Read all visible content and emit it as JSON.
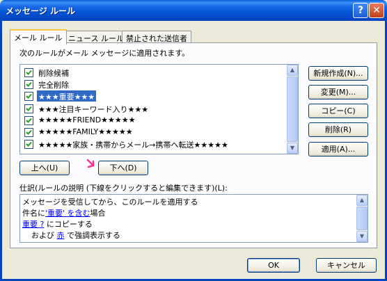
{
  "window": {
    "title": "メッセージ ルール",
    "help_glyph": "?",
    "close_glyph": "✕"
  },
  "tabs": [
    {
      "label": "メール ルール",
      "active": true
    },
    {
      "label": "ニュース ルール",
      "active": false
    },
    {
      "label": "禁止された送信者",
      "active": false
    }
  ],
  "rules_header": "次のルールがメール メッセージに適用されます。",
  "rules": [
    {
      "label": "削除候補",
      "checked": true,
      "selected": false
    },
    {
      "label": "完全削除",
      "checked": true,
      "selected": false
    },
    {
      "label": "★★★重要★★★",
      "checked": true,
      "selected": true
    },
    {
      "label": "★★★注目キーワード入り★★★",
      "checked": true,
      "selected": false
    },
    {
      "label": "★★★★★FRIEND★★★★★",
      "checked": true,
      "selected": false
    },
    {
      "label": "★★★★★FAMILY★★★★★",
      "checked": true,
      "selected": false
    },
    {
      "label": "★★★★★家族・携帯からメール→携帯へ転送★★★★★",
      "checked": true,
      "selected": false
    }
  ],
  "side_buttons": {
    "new": "新規作成(N)...",
    "modify": "変更(M)...",
    "copy": "コピー(C)",
    "remove": "削除(R)",
    "apply": "適用(A)..."
  },
  "move_buttons": {
    "up": "上へ(U)",
    "down": "下へ(D)"
  },
  "description_label": "仕訳(ルールの説明 (下線をクリックすると編集できます)(L):",
  "description": {
    "line1": "メッセージを受信してから、このルールを適用する",
    "line2_pre": "件名に",
    "line2_link": "'重要' を含む",
    "line2_post": "場合",
    "line3_link": "重要 ?",
    "line3_post": " にコピーする",
    "line4_pre": "および ",
    "line4_link": "赤",
    "line4_post": " で強調表示する"
  },
  "footer_buttons": {
    "ok": "OK",
    "cancel": "キャンセル"
  },
  "colors": {
    "title_bar": "#0454d6",
    "selection": "#316ac5",
    "link": "#0000ff",
    "annotation_arrow": "#ff2e9a"
  },
  "icons": {
    "scroll_up": "▲",
    "scroll_down": "▼"
  }
}
